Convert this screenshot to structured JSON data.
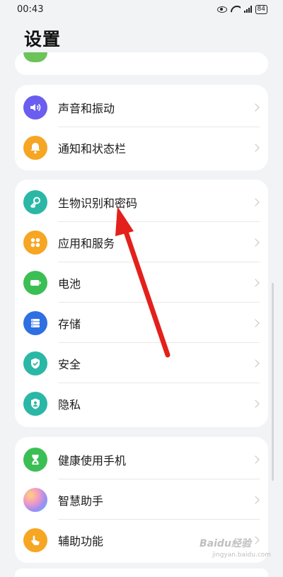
{
  "status_bar": {
    "time": "00:43",
    "battery": "84"
  },
  "page_title": "设置",
  "groups": [
    {
      "items": [
        {
          "label": "声音和振动",
          "icon": "speaker-icon",
          "color": "#6a5df0"
        },
        {
          "label": "通知和状态栏",
          "icon": "bell-icon",
          "color": "#f6a623"
        }
      ]
    },
    {
      "items": [
        {
          "label": "生物识别和密码",
          "icon": "key-icon",
          "color": "#2bb7a6"
        },
        {
          "label": "应用和服务",
          "icon": "apps-grid-icon",
          "color": "#f6a623"
        },
        {
          "label": "电池",
          "icon": "battery-icon",
          "color": "#3bbf55"
        },
        {
          "label": "存储",
          "icon": "storage-icon",
          "color": "#2f6fe4"
        },
        {
          "label": "安全",
          "icon": "shield-check-icon",
          "color": "#2bb7a6"
        },
        {
          "label": "隐私",
          "icon": "privacy-shield-icon",
          "color": "#2bb7a6"
        }
      ]
    },
    {
      "items": [
        {
          "label": "健康使用手机",
          "icon": "hourglass-icon",
          "color": "#3bbf55"
        },
        {
          "label": "智慧助手",
          "icon": "assistant-orb-icon",
          "color": "#b98ef0"
        },
        {
          "label": "辅助功能",
          "icon": "hand-icon",
          "color": "#f6a623"
        }
      ]
    }
  ],
  "watermark": {
    "text": "Baidu经验",
    "sub": "jingyan.baidu.com"
  },
  "annotation": {
    "arrow_color": "#e3201b"
  }
}
